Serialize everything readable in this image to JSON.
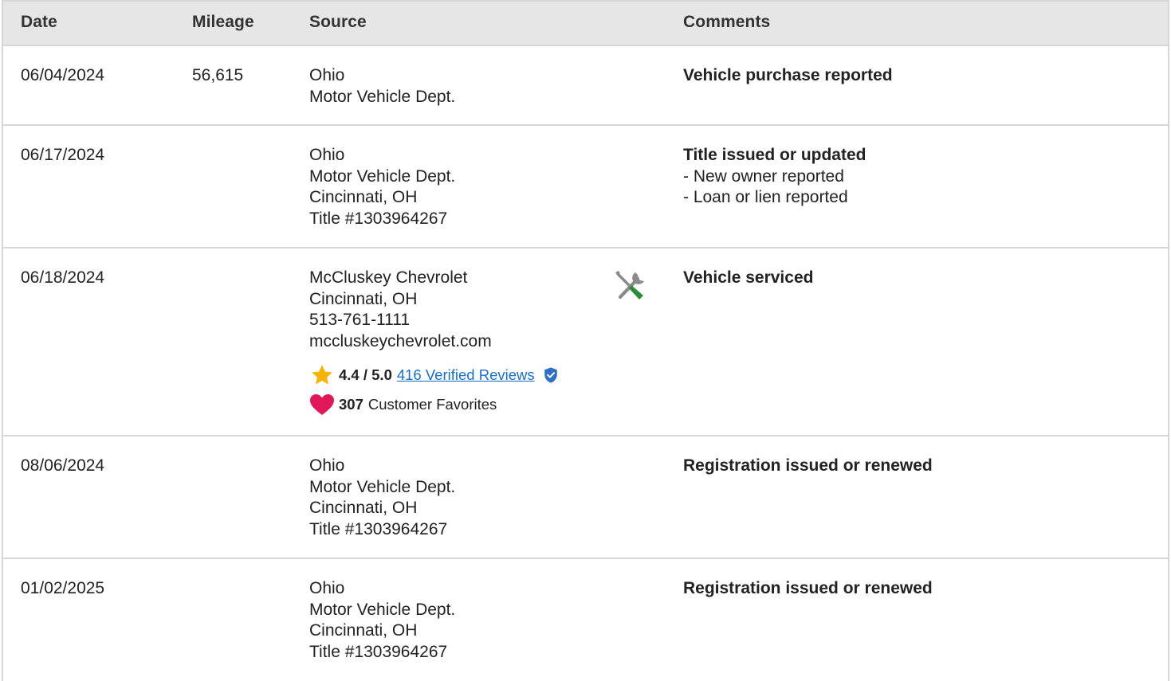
{
  "header": {
    "date": "Date",
    "mileage": "Mileage",
    "source": "Source",
    "comments": "Comments"
  },
  "rows": [
    {
      "date": "06/04/2024",
      "mileage": "56,615",
      "source": [
        "Ohio",
        "Motor Vehicle Dept."
      ],
      "comment_title": "Vehicle purchase reported",
      "comment_items": []
    },
    {
      "date": "06/17/2024",
      "mileage": "",
      "source": [
        "Ohio",
        "Motor Vehicle Dept.",
        "Cincinnati, OH",
        "Title #1303964267"
      ],
      "comment_title": "Title issued or updated",
      "comment_items": [
        "- New owner reported",
        "- Loan or lien reported"
      ]
    },
    {
      "date": "06/18/2024",
      "mileage": "",
      "source": [
        "McCluskey Chevrolet",
        "Cincinnati, OH",
        "513-761-1111",
        "mccluskeychevrolet.com"
      ],
      "rating": {
        "score": "4.4 / 5.0",
        "reviews_link": "416 Verified Reviews",
        "favorites_count": "307",
        "favorites_label": "Customer Favorites"
      },
      "icon": "service-tools-icon",
      "comment_title": "Vehicle serviced",
      "comment_items": []
    },
    {
      "date": "08/06/2024",
      "mileage": "",
      "source": [
        "Ohio",
        "Motor Vehicle Dept.",
        "Cincinnati, OH",
        "Title #1303964267"
      ],
      "comment_title": "Registration issued or renewed",
      "comment_items": []
    },
    {
      "date": "01/02/2025",
      "mileage": "",
      "source": [
        "Ohio",
        "Motor Vehicle Dept.",
        "Cincinnati, OH",
        "Title #1303964267"
      ],
      "comment_title": "Registration issued or renewed",
      "comment_items": []
    }
  ],
  "colors": {
    "header_bg": "#e6e6e6",
    "border": "#d6d6d6",
    "link": "#1a6fc9",
    "star": "#f5b400",
    "heart": "#e0185a",
    "shield": "#2f6fc4",
    "tool_gray": "#8a8a8a",
    "tool_green": "#2e8b3a"
  }
}
